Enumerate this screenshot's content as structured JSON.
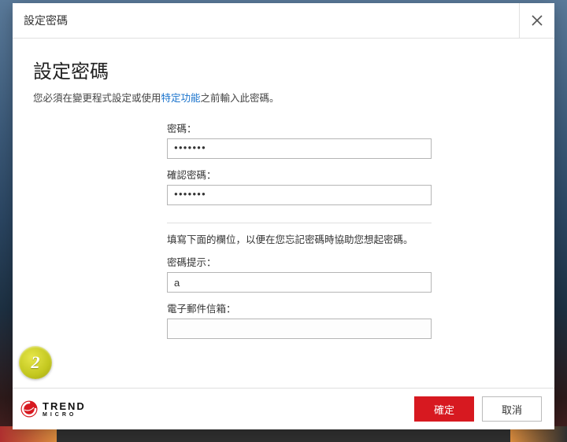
{
  "titlebar": {
    "title": "設定密碼"
  },
  "content": {
    "heading": "設定密碼",
    "subtext_before": "您必須在變更程式設定或使用",
    "subtext_link": "特定功能",
    "subtext_after": "之前輸入此密碼。",
    "password_label": "密碼：",
    "password_value": "●●●●●●●",
    "confirm_label": "確認密碼：",
    "confirm_value": "●●●●●●●",
    "help_text": "填寫下面的欄位，以便在您忘記密碼時協助您想起密碼。",
    "hint_label": "密碼提示：",
    "hint_value": "a",
    "email_label": "電子郵件信箱：",
    "email_value": ""
  },
  "footer": {
    "brand_top": "TREND",
    "brand_bottom": "MICRO",
    "ok_label": "確定",
    "cancel_label": "取消"
  },
  "badge": {
    "number": "2"
  }
}
